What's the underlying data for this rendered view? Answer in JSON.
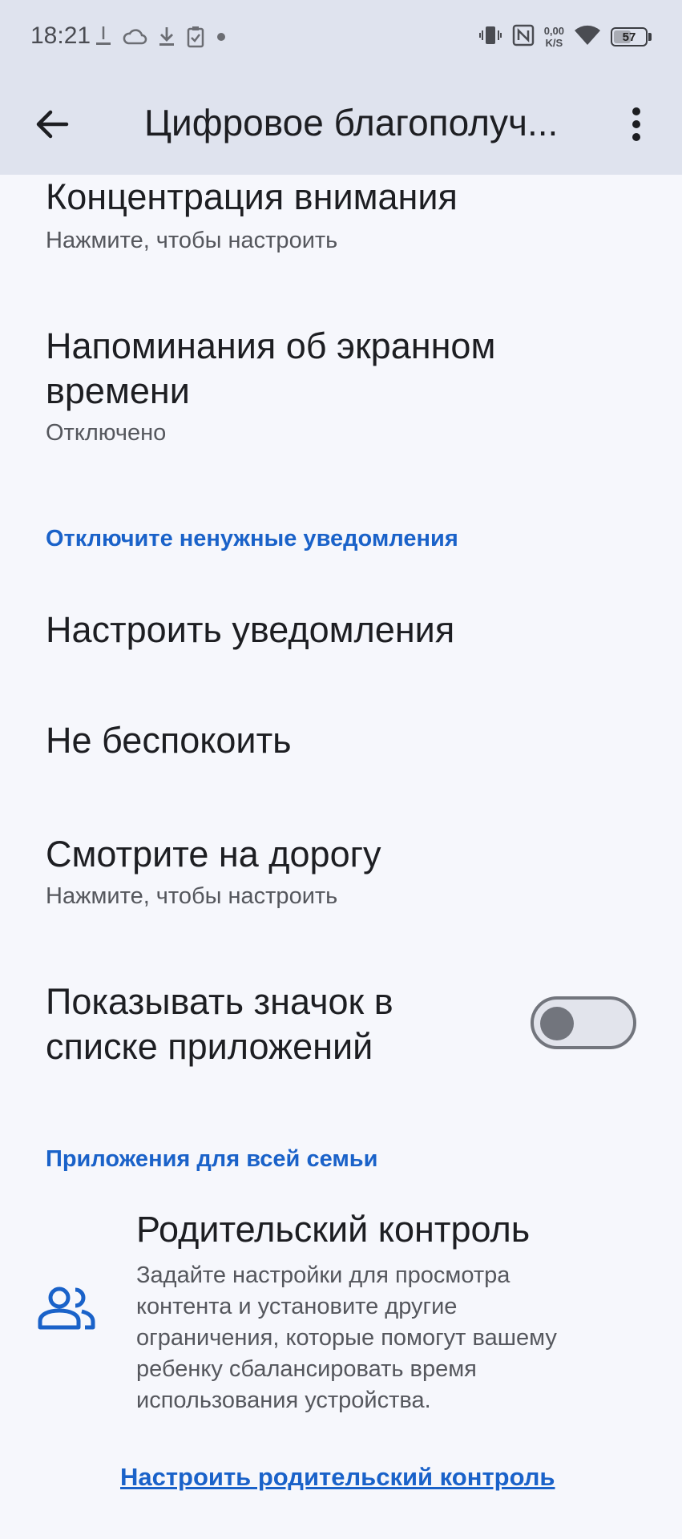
{
  "status_bar": {
    "time": "18:21",
    "net_speed_value": "0,00",
    "net_speed_unit": "K/S",
    "battery_level": "57"
  },
  "app_bar": {
    "title": "Цифровое благополуч..."
  },
  "items": {
    "focus": {
      "title": "Концентрация внимания",
      "subtitle": "Нажмите, чтобы настроить"
    },
    "screen_time_reminders": {
      "title_line1": "Напоминания об экранном",
      "title_line2": "времени",
      "subtitle": "Отключено"
    },
    "section_notifications": "Отключите ненужные уведомления",
    "manage_notifications": {
      "title": "Настроить уведомления"
    },
    "do_not_disturb": {
      "title": "Не беспокоить"
    },
    "heads_up": {
      "title": "Смотрите на дорогу",
      "subtitle": "Нажмите, чтобы настроить"
    },
    "show_icon": {
      "title_line1": "Показывать значок в",
      "title_line2": "списке приложений",
      "enabled": false
    },
    "section_family": "Приложения для всей семьи",
    "parental_controls": {
      "title": "Родительский контроль",
      "desc_lines": [
        "Задайте настройки для просмотра",
        "контента и установите другие",
        "ограничения, которые помогут вашему",
        "ребенку сбалансировать время",
        "использования устройства."
      ],
      "link": "Настроить родительский контроль"
    }
  },
  "colors": {
    "accent": "#1a62c9",
    "header_bg": "#dfe3ee",
    "page_bg": "#f6f7fc"
  }
}
